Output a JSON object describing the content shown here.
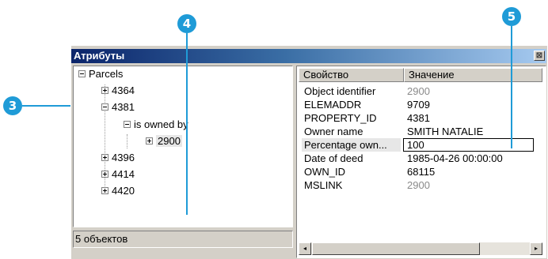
{
  "callouts": {
    "c3": "3",
    "c4": "4",
    "c5": "5"
  },
  "window": {
    "title": "Атрибуты",
    "close_glyph": "⊠"
  },
  "tree": {
    "root": "Parcels",
    "items": [
      "4364",
      "4381",
      "is owned by",
      "2900",
      "4396",
      "4414",
      "4420"
    ]
  },
  "status": "5 объектов",
  "grid": {
    "headers": {
      "property": "Свойство",
      "value": "Значение"
    },
    "rows": [
      {
        "name": "Object identifier",
        "value": "2900"
      },
      {
        "name": "ELEMADDR",
        "value": "9709"
      },
      {
        "name": "PROPERTY_ID",
        "value": "4381"
      },
      {
        "name": "Owner name",
        "value": "SMITH NATALIE"
      },
      {
        "name": "Percentage own...",
        "value": "100"
      },
      {
        "name": "Date of deed",
        "value": "1985-04-26 00:00:00"
      },
      {
        "name": "OWN_ID",
        "value": "68115"
      },
      {
        "name": "MSLINK",
        "value": "2900"
      }
    ]
  },
  "scroll": {
    "left_glyph": "◂",
    "right_glyph": "▸"
  },
  "colors": {
    "callout": "#1f9bd7",
    "titlebar_start": "#0b246a",
    "titlebar_end": "#a6caf0",
    "window_face": "#d4d0c8"
  }
}
